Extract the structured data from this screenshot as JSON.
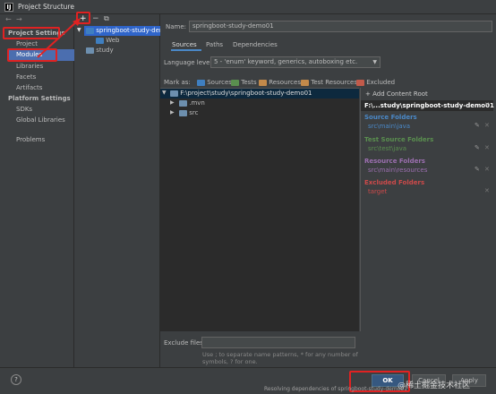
{
  "window": {
    "title": "Project Structure",
    "logo": "IJ"
  },
  "sidebar": {
    "project_settings_heading": "Project Settings",
    "items": [
      "Project",
      "Modules",
      "Libraries",
      "Facets",
      "Artifacts"
    ],
    "platform_settings_heading": "Platform Settings",
    "platform_items": [
      "SDKs",
      "Global Libraries"
    ],
    "problems": "Problems"
  },
  "tree": {
    "add": "+",
    "remove": "−",
    "copy": "⧉",
    "module": "springboot-study-demo01",
    "web": "Web",
    "study": "study"
  },
  "main": {
    "name_label": "Name:",
    "name_value": "springboot-study-demo01",
    "tabs": [
      "Sources",
      "Paths",
      "Dependencies"
    ],
    "language_level_label": "Language level:",
    "language_level_value": "5 - 'enum' keyword, generics, autoboxing etc.",
    "mark_as_label": "Mark as:",
    "mark_as": [
      "Sources",
      "Tests",
      "Resources",
      "Test Resources",
      "Excluded"
    ],
    "content_root_path": "F:\\project\\study\\springboot-study-demo01",
    "children": [
      ".mvn",
      "src"
    ],
    "exclude_files_label": "Exclude files:",
    "exclude_hint_line1": "Use ; to separate name patterns, * for any number of",
    "exclude_hint_line2": "symbols, ? for one."
  },
  "right": {
    "add_content_root": "+ Add Content Root",
    "root_title": "F:\\...study\\springboot-study-demo01",
    "source_folders": "Source Folders",
    "source_path": "src\\main\\java",
    "test_source_folders": "Test Source Folders",
    "test_path": "src\\test\\java",
    "resource_folders": "Resource Folders",
    "resource_path": "src\\main\\resources",
    "excluded_folders": "Excluded Folders",
    "excluded_path": "target"
  },
  "bottom": {
    "help": "?",
    "ok": "OK",
    "cancel": "Cancel",
    "apply": "Apply"
  },
  "overlay": {
    "watermark": "@稀土掘金技术社区",
    "status": "Resolving dependencies of springboot-study-demo01"
  },
  "colors": {
    "accent": "#4b6eaf",
    "annotation": "#e02222",
    "source": "#4a88c7",
    "test": "#5a8f4f",
    "resource": "#9c6fb0",
    "excluded": "#cc4a4a"
  }
}
